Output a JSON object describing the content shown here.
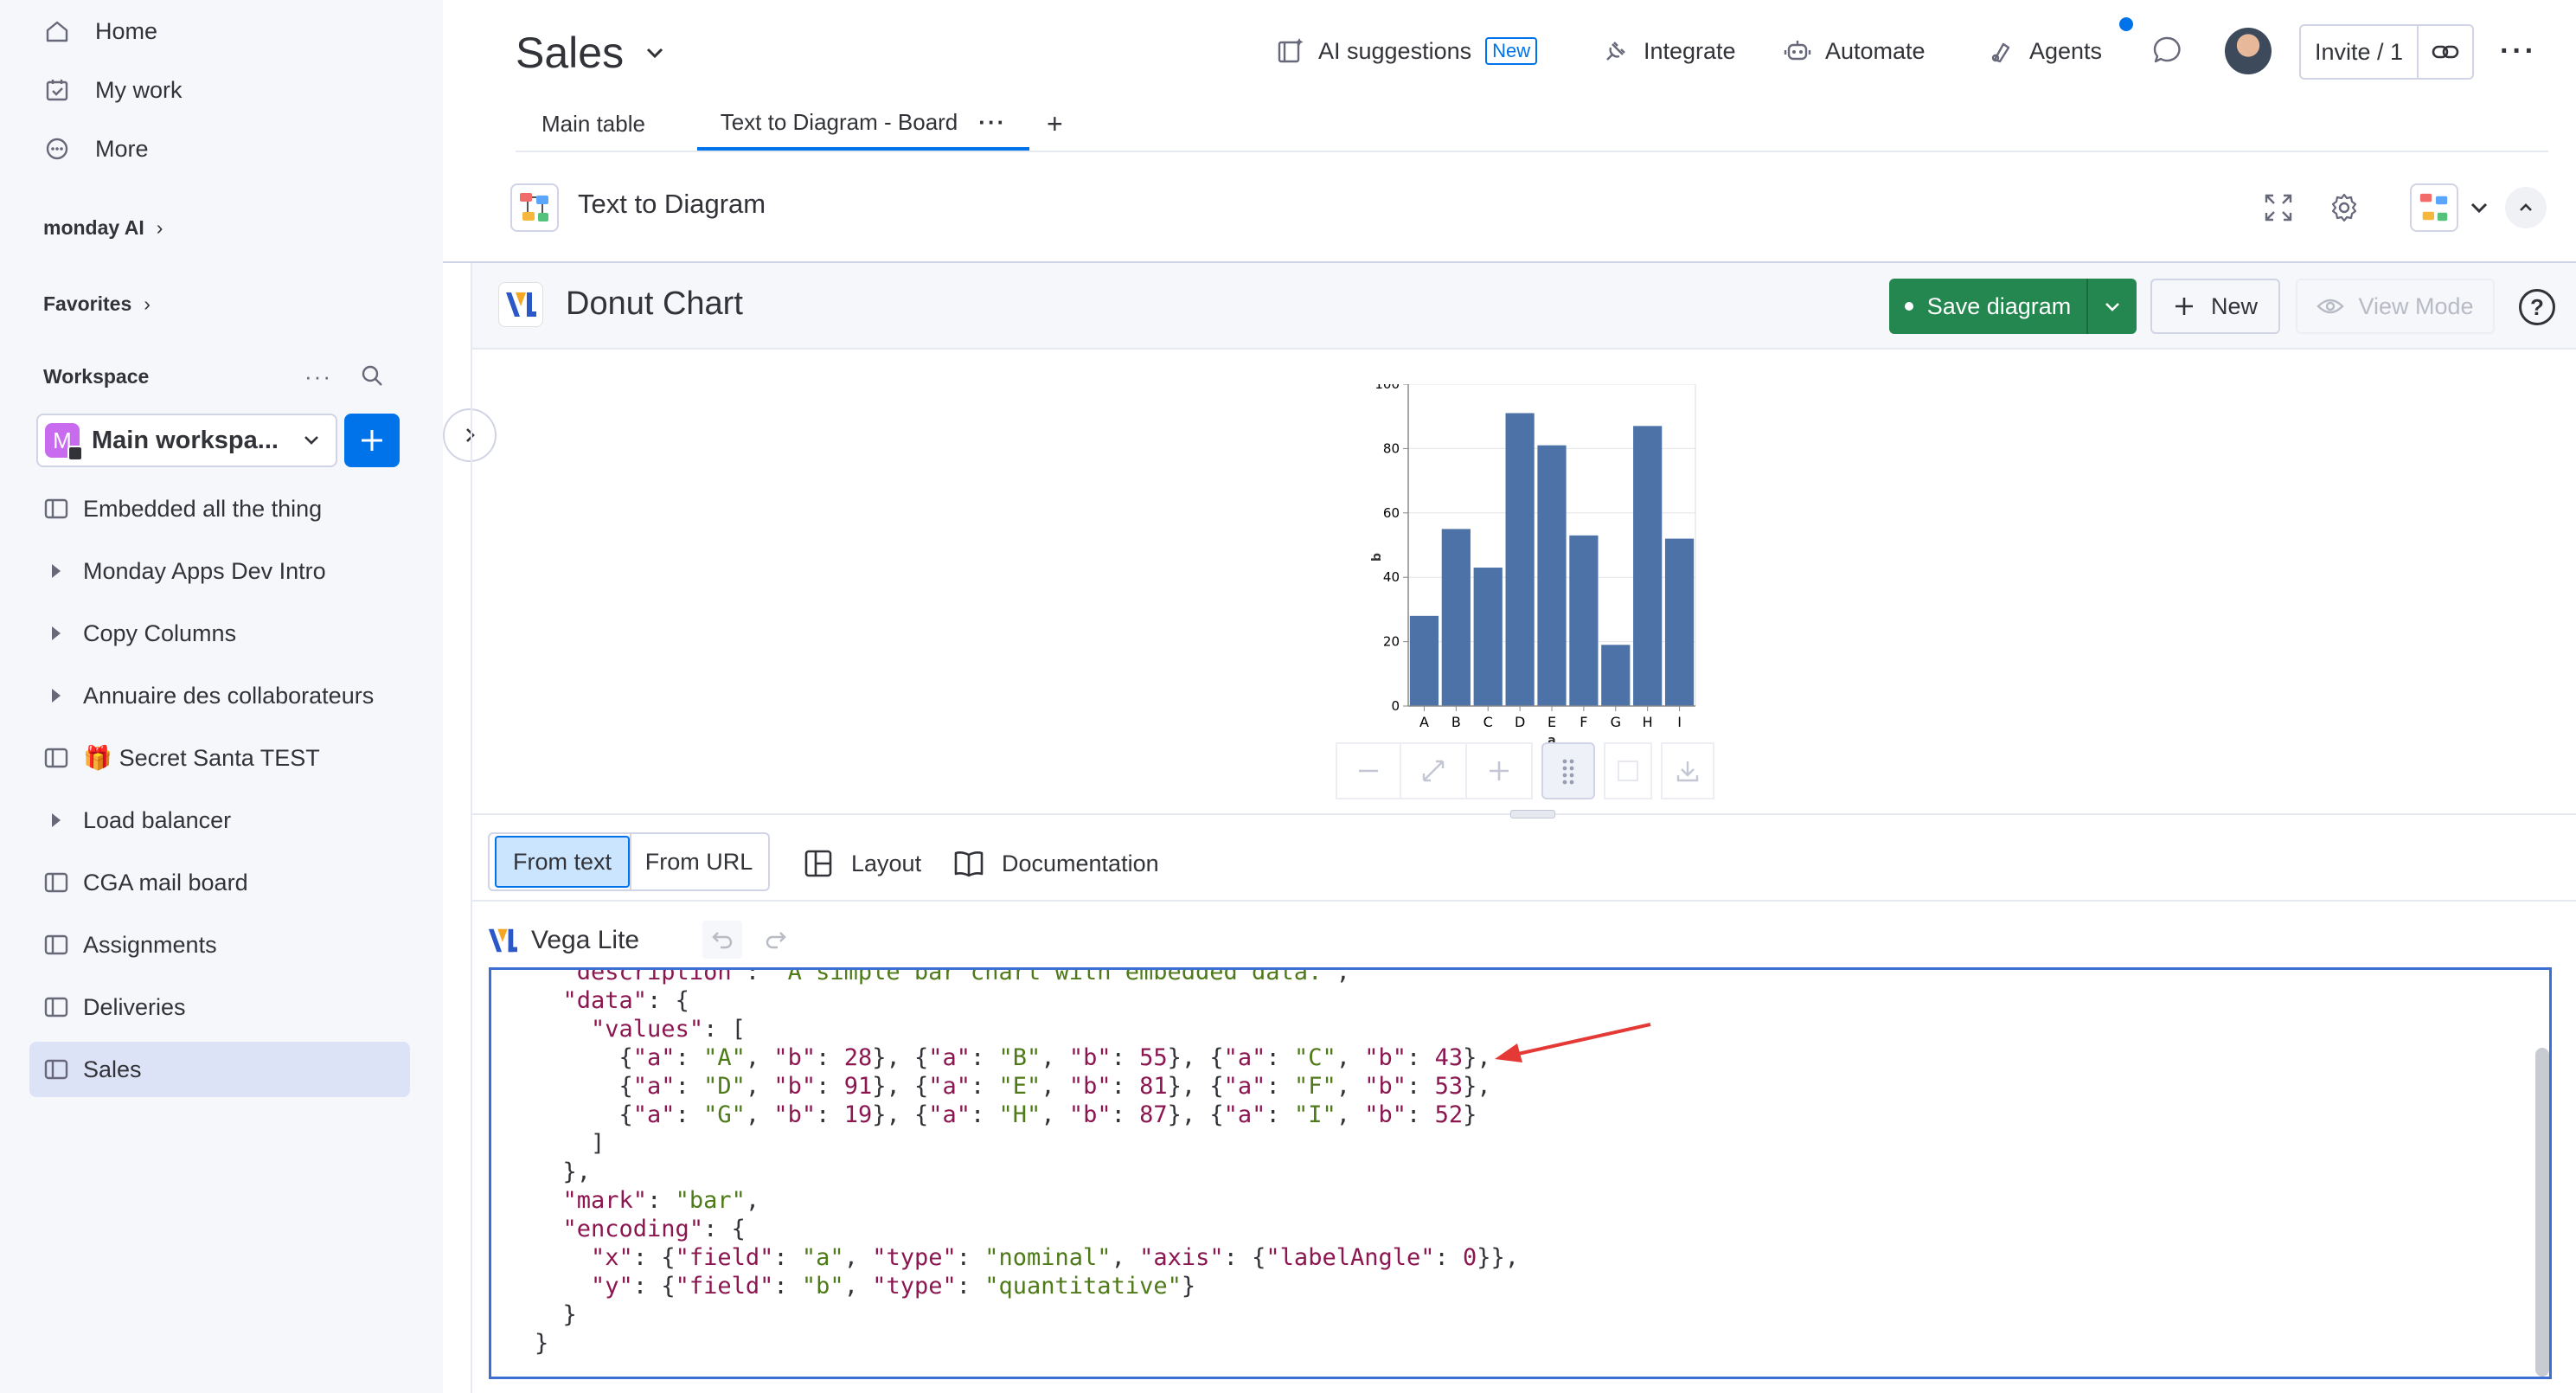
{
  "sidebar": {
    "nav": [
      {
        "label": "Home",
        "icon": "home-icon"
      },
      {
        "label": "My work",
        "icon": "calendar-check-icon"
      },
      {
        "label": "More",
        "icon": "more-circle-icon"
      }
    ],
    "monday_ai": "monday AI",
    "favorites": "Favorites",
    "workspace": "Workspace",
    "workspace_name": "Main workspa...",
    "workspace_initial": "M",
    "items": [
      {
        "label": "Embedded all the thing",
        "type": "board"
      },
      {
        "label": "Monday Apps Dev Intro",
        "type": "folder"
      },
      {
        "label": "Copy Columns",
        "type": "folder"
      },
      {
        "label": "Annuaire des collaborateurs",
        "type": "folder"
      },
      {
        "label": "Secret Santa TEST",
        "type": "board",
        "emoji": "🎁"
      },
      {
        "label": "Load balancer",
        "type": "folder"
      },
      {
        "label": "CGA mail board",
        "type": "board"
      },
      {
        "label": "Assignments",
        "type": "board"
      },
      {
        "label": "Deliveries",
        "type": "board"
      },
      {
        "label": "Sales",
        "type": "board",
        "active": true
      }
    ]
  },
  "header": {
    "title": "Sales",
    "ai_suggestions": "AI suggestions",
    "new_badge": "New",
    "integrate": "Integrate",
    "automate": "Automate",
    "agents": "Agents",
    "invite": "Invite / 1"
  },
  "tabs": {
    "main_table": "Main table",
    "text_to_diagram": "Text to Diagram - Board",
    "more": "···",
    "add": "+"
  },
  "widget": {
    "title": "Text to Diagram"
  },
  "diagram": {
    "title": "Donut Chart",
    "save": "Save diagram",
    "new": "New",
    "view_mode": "View Mode",
    "help": "?"
  },
  "editor": {
    "from_text": "From text",
    "from_url": "From URL",
    "layout": "Layout",
    "documentation": "Documentation",
    "language": "Vega Lite"
  },
  "code_lines": [
    "\"description\": \"A simple bar chart with embedded data.\",",
    "\"data\": {",
    "  \"values\": [",
    "    {\"a\": \"A\", \"b\": 28}, {\"a\": \"B\", \"b\": 55}, {\"a\": \"C\", \"b\": 43},",
    "    {\"a\": \"D\", \"b\": 91}, {\"a\": \"E\", \"b\": 81}, {\"a\": \"F\", \"b\": 53},",
    "    {\"a\": \"G\", \"b\": 19}, {\"a\": \"H\", \"b\": 87}, {\"a\": \"I\", \"b\": 52}",
    "  ]",
    "},",
    "\"mark\": \"bar\",",
    "\"encoding\": {",
    "  \"x\": {\"field\": \"a\", \"type\": \"nominal\", \"axis\": {\"labelAngle\": 0}},",
    "  \"y\": {\"field\": \"b\", \"type\": \"quantitative\"}",
    "}"
  ],
  "code_last": "}",
  "colors": {
    "accent": "#0073ea",
    "save_green": "#258750",
    "bar": "#4c72a8",
    "active_item": "#dce3f6"
  },
  "chart_data": {
    "type": "bar",
    "categories": [
      "A",
      "B",
      "C",
      "D",
      "E",
      "F",
      "G",
      "H",
      "I"
    ],
    "values": [
      28,
      55,
      43,
      91,
      81,
      53,
      19,
      87,
      52
    ],
    "xlabel": "a",
    "ylabel": "b",
    "ylim": [
      0,
      100
    ],
    "yticks": [
      0,
      20,
      40,
      60,
      80,
      100
    ],
    "grid": true
  }
}
